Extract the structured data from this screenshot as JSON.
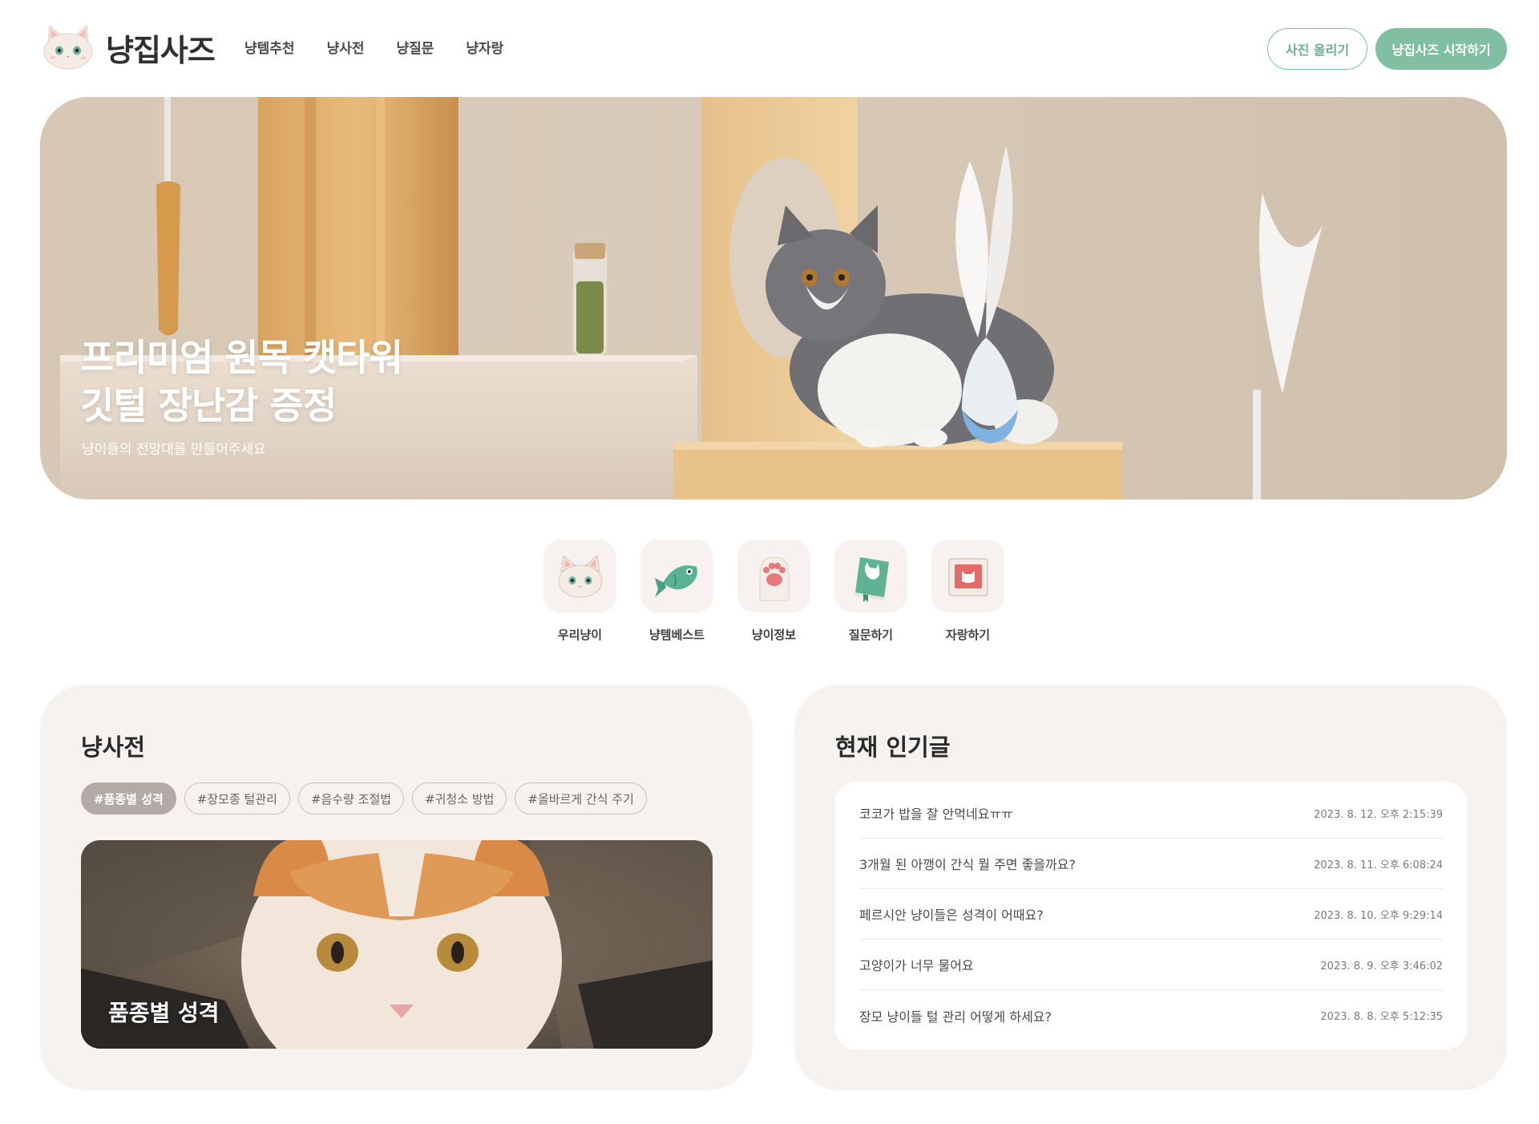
{
  "header": {
    "logo_text": "냥집사즈",
    "nav": [
      "냥템추천",
      "냥사전",
      "냥질문",
      "냥자랑"
    ],
    "upload_label": "사진 올리기",
    "start_label": "냥집사즈 시작하기"
  },
  "hero": {
    "title_line1": "프리미엄 원목 캣타워",
    "title_line2": "깃털 장난감 증정",
    "subtitle": "냥이들의 전망대를 만들어주세요"
  },
  "quick_menu": [
    {
      "label": "우리냥이",
      "icon": "cat-face-icon"
    },
    {
      "label": "냥템베스트",
      "icon": "fish-icon"
    },
    {
      "label": "냥이정보",
      "icon": "paw-icon"
    },
    {
      "label": "질문하기",
      "icon": "book-icon"
    },
    {
      "label": "자랑하기",
      "icon": "photo-frame-icon"
    }
  ],
  "dictionary": {
    "title": "냥사전",
    "tags": [
      "#품종별 성격",
      "#장모종 털관리",
      "#음수량 조절법",
      "#귀청소 방법",
      "#올바르게 간식 주기"
    ],
    "active_tag": 0,
    "feature_label": "품종별 성격"
  },
  "popular": {
    "title": "현재 인기글",
    "posts": [
      {
        "title": "코코가 밥을 잘 안먹네요ㅠㅠ",
        "date": "2023. 8. 12. 오후 2:15:39"
      },
      {
        "title": "3개월 된 아깽이 간식 뭘 주면 좋을까요?",
        "date": "2023. 8. 11. 오후 6:08:24"
      },
      {
        "title": "페르시안 냥이들은 성격이 어때요?",
        "date": "2023. 8. 10. 오후 9:29:14"
      },
      {
        "title": "고양이가 너무 물어요",
        "date": "2023. 8. 9. 오후 3:46:02"
      },
      {
        "title": "장모 냥이들 털 관리 어떻게 하세요?",
        "date": "2023. 8. 8. 오후 5:12:35"
      }
    ]
  },
  "colors": {
    "accent": "#80bfa1",
    "card_bg": "#f6f2f0",
    "tag_active": "#b3aaa5"
  }
}
